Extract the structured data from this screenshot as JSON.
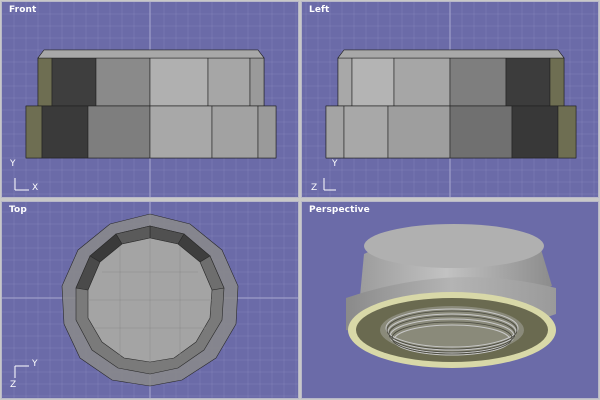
{
  "viewports": {
    "front": {
      "label": "Front",
      "axis_v": "Y",
      "axis_h": "X"
    },
    "left": {
      "label": "Left",
      "axis_v": "Y",
      "axis_h": "Z"
    },
    "top": {
      "label": "Top",
      "axis_v": "Y",
      "axis_h": "Z"
    },
    "perspective": {
      "label": "Perspective"
    }
  },
  "colors": {
    "viewport_bg": "#6b6ba8",
    "grid_line": "#8282b8",
    "grid_major": "#a8a8d0",
    "model_light": "#b4b4b4",
    "model_mid": "#8a8a8a",
    "model_dark": "#404040",
    "model_edge_olive": "#6e6e52",
    "selection_tint": "#d8d8a8"
  }
}
